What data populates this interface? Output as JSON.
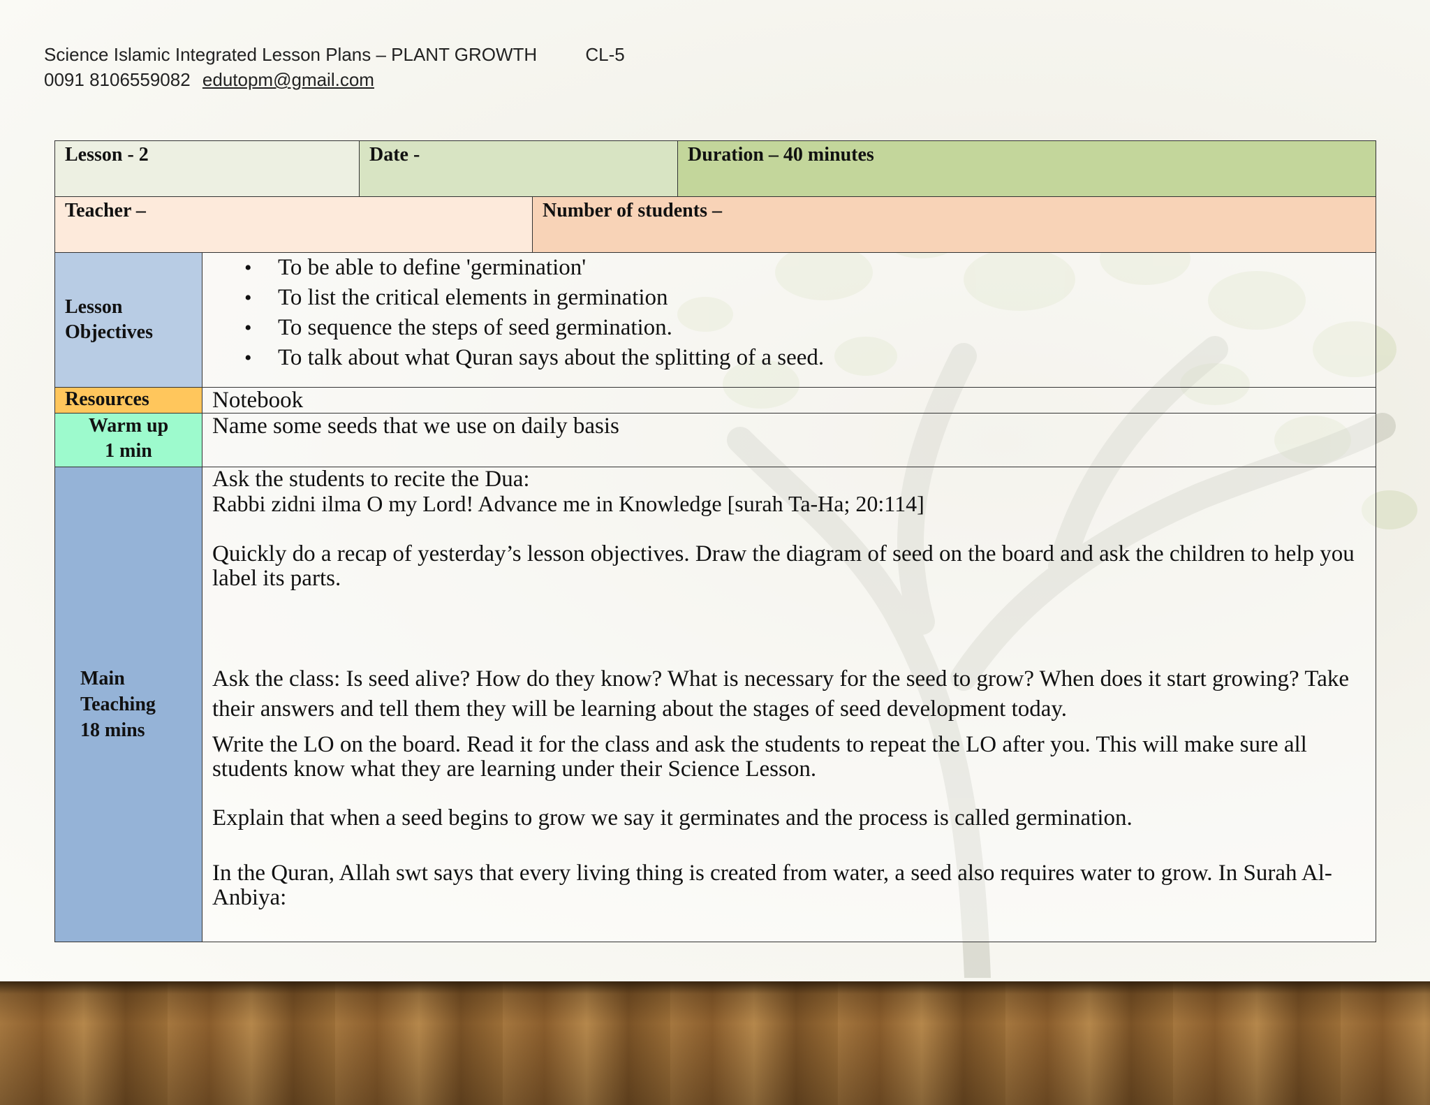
{
  "header": {
    "title": "Science Islamic Integrated Lesson Plans – PLANT GROWTH",
    "class_label": "CL-5",
    "phone": "0091 8106559082",
    "email": "edutopm@gmail.com"
  },
  "row1": {
    "lesson": "Lesson - 2",
    "date": "Date -",
    "duration": "Duration – 40 minutes"
  },
  "row2": {
    "teacher": "Teacher –",
    "students": "Number of students –"
  },
  "objectives": {
    "label_line1": "Lesson",
    "label_line2": "Objectives",
    "items": [
      "To be able to define 'germination'",
      "To list the critical elements in germination",
      "To sequence the steps of seed germination.",
      "To talk about what Quran says about the splitting of a seed."
    ]
  },
  "resources": {
    "label": "Resources",
    "value": "Notebook"
  },
  "warmup": {
    "label_line1": "Warm up",
    "label_line2": "1 min",
    "value": "Name some seeds that we use on daily basis"
  },
  "main_teaching": {
    "label_line1": "Main",
    "label_line2": "Teaching",
    "label_line3": "18 mins",
    "p1_line1": "Ask the students to recite the Dua:",
    "p1_line2": "Rabbi zidni ilma O my Lord! Advance me in Knowledge [surah Ta-Ha; 20:114]",
    "p2": "Quickly do a recap of yesterday’s lesson objectives. Draw the diagram of seed on the board and ask the children to help  you label its parts.",
    "p3": "Ask the class: Is seed alive? How do they know? What is necessary for the seed to grow? When does it start growing?  Take their answers and tell them they will be learning about the stages of seed development today.",
    "p4": "Write the LO on the board. Read it for the class and ask the students to repeat the LO after you. This will make sure all  students know what they are learning under their Science Lesson.",
    "p5": "Explain that when a seed begins to grow we say it germinates and the process is called germination.",
    "p6": "In the Quran, Allah swt says that every living thing is created from water, a seed also requires water to grow. In Surah Al-  Anbiya:"
  }
}
